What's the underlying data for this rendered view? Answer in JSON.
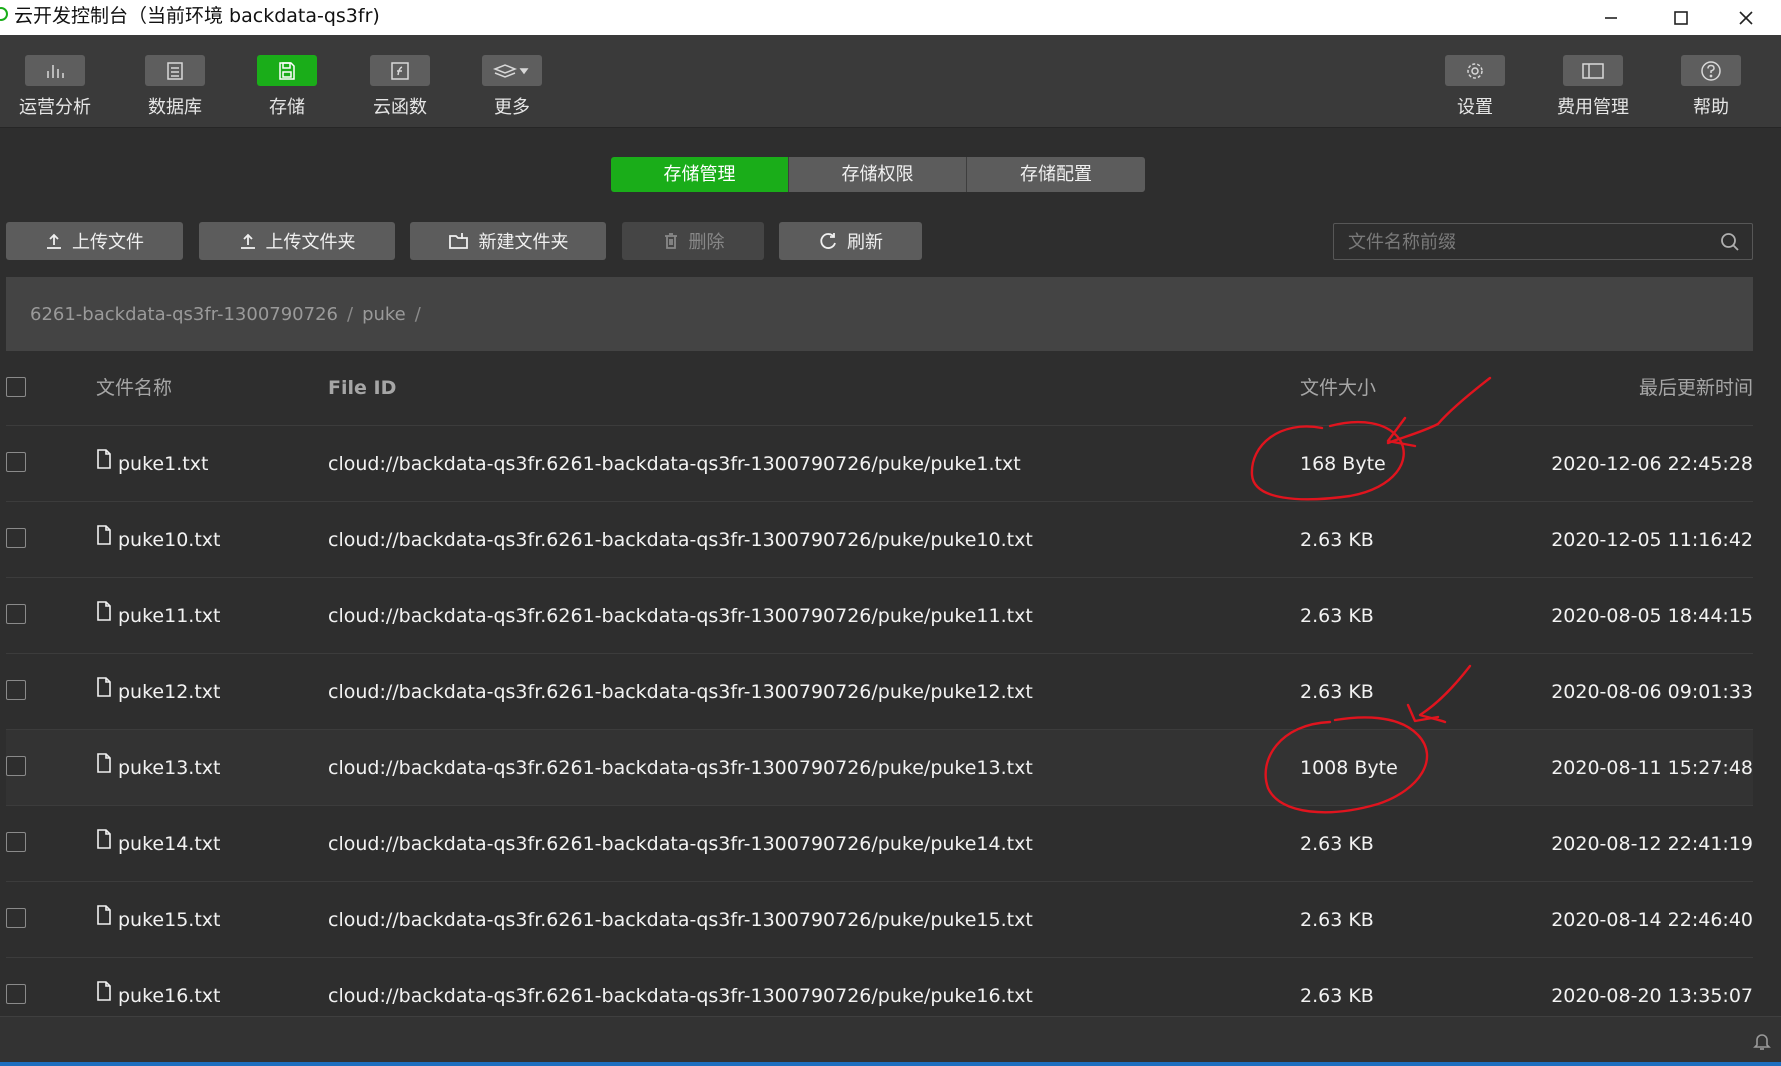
{
  "window": {
    "title": "云开发控制台（当前环境 backdata-qs3fr)"
  },
  "toolbar": {
    "left": [
      {
        "label": "运营分析",
        "icon": "bar-chart-icon"
      },
      {
        "label": "数据库",
        "icon": "database-icon"
      },
      {
        "label": "存储",
        "icon": "storage-icon"
      },
      {
        "label": "云函数",
        "icon": "function-icon"
      },
      {
        "label": "更多",
        "icon": "layers-icon"
      }
    ],
    "right": [
      {
        "label": "设置",
        "icon": "gear-icon"
      },
      {
        "label": "费用管理",
        "icon": "billing-icon"
      },
      {
        "label": "帮助",
        "icon": "help-icon"
      }
    ],
    "active": "存储"
  },
  "tabs": [
    "存储管理",
    "存储权限",
    "存储配置"
  ],
  "actions": {
    "upload_file": "上传文件",
    "upload_folder": "上传文件夹",
    "new_folder": "新建文件夹",
    "delete": "删除",
    "refresh": "刷新"
  },
  "search": {
    "placeholder": "文件名称前缀"
  },
  "breadcrumb": [
    "6261-backdata-qs3fr-1300790726",
    "puke"
  ],
  "table": {
    "headers": {
      "name": "文件名称",
      "id": "File ID",
      "size": "文件大小",
      "time": "最后更新时间"
    },
    "rows": [
      {
        "name": "puke1.txt",
        "id": "cloud://backdata-qs3fr.6261-backdata-qs3fr-1300790726/puke/puke1.txt",
        "size": "168 Byte",
        "time": "2020-12-06 22:45:28"
      },
      {
        "name": "puke10.txt",
        "id": "cloud://backdata-qs3fr.6261-backdata-qs3fr-1300790726/puke/puke10.txt",
        "size": "2.63 KB",
        "time": "2020-12-05 11:16:42"
      },
      {
        "name": "puke11.txt",
        "id": "cloud://backdata-qs3fr.6261-backdata-qs3fr-1300790726/puke/puke11.txt",
        "size": "2.63 KB",
        "time": "2020-08-05 18:44:15"
      },
      {
        "name": "puke12.txt",
        "id": "cloud://backdata-qs3fr.6261-backdata-qs3fr-1300790726/puke/puke12.txt",
        "size": "2.63 KB",
        "time": "2020-08-06 09:01:33"
      },
      {
        "name": "puke13.txt",
        "id": "cloud://backdata-qs3fr.6261-backdata-qs3fr-1300790726/puke/puke13.txt",
        "size": "1008 Byte",
        "time": "2020-08-11 15:27:48"
      },
      {
        "name": "puke14.txt",
        "id": "cloud://backdata-qs3fr.6261-backdata-qs3fr-1300790726/puke/puke14.txt",
        "size": "2.63 KB",
        "time": "2020-08-12 22:41:19"
      },
      {
        "name": "puke15.txt",
        "id": "cloud://backdata-qs3fr.6261-backdata-qs3fr-1300790726/puke/puke15.txt",
        "size": "2.63 KB",
        "time": "2020-08-14 22:46:40"
      },
      {
        "name": "puke16.txt",
        "id": "cloud://backdata-qs3fr.6261-backdata-qs3fr-1300790726/puke/puke16.txt",
        "size": "2.63 KB",
        "time": "2020-08-20 13:35:07"
      }
    ]
  },
  "colors": {
    "accent": "#1aad19",
    "annotation": "#e0141e",
    "background": "#2e2e2e"
  }
}
